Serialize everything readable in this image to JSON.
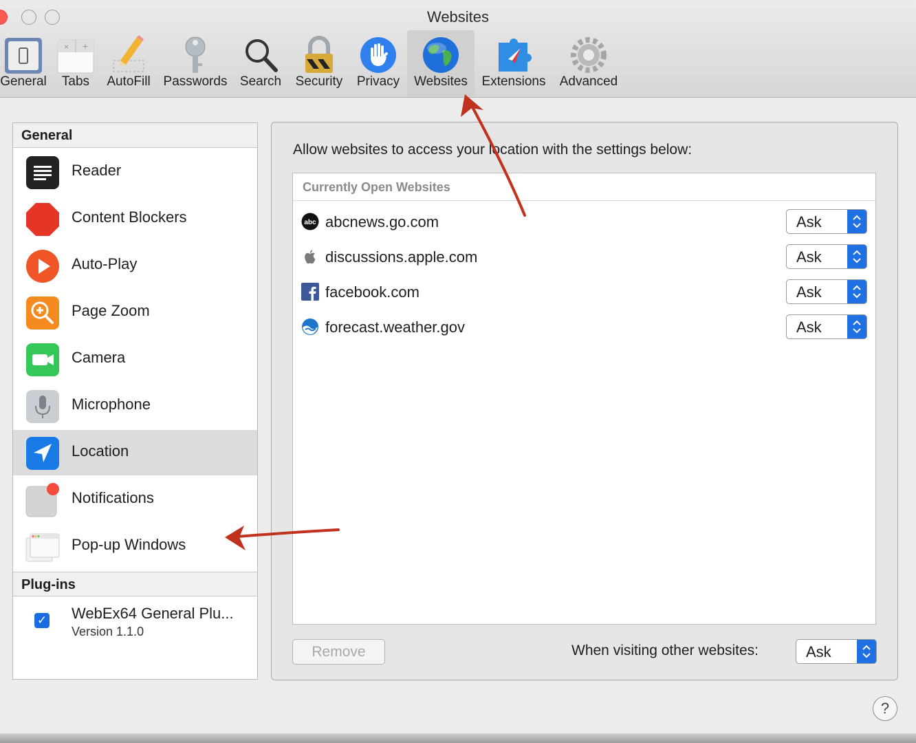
{
  "window": {
    "title": "Websites"
  },
  "toolbar": {
    "items": [
      {
        "label": "General",
        "icon": "general-switch-icon"
      },
      {
        "label": "Tabs",
        "icon": "tabs-icon"
      },
      {
        "label": "AutoFill",
        "icon": "pencil-icon"
      },
      {
        "label": "Passwords",
        "icon": "key-icon"
      },
      {
        "label": "Search",
        "icon": "magnifier-icon"
      },
      {
        "label": "Security",
        "icon": "padlock-icon"
      },
      {
        "label": "Privacy",
        "icon": "hand-icon"
      },
      {
        "label": "Websites",
        "icon": "globe-icon",
        "selected": true
      },
      {
        "label": "Extensions",
        "icon": "puzzle-piece-icon"
      },
      {
        "label": "Advanced",
        "icon": "gear-icon"
      }
    ]
  },
  "sidebar": {
    "general_header": "General",
    "items": [
      {
        "label": "Reader",
        "icon": "reader-icon"
      },
      {
        "label": "Content Blockers",
        "icon": "stop-sign-icon"
      },
      {
        "label": "Auto-Play",
        "icon": "play-icon"
      },
      {
        "label": "Page Zoom",
        "icon": "zoom-icon"
      },
      {
        "label": "Camera",
        "icon": "camera-icon"
      },
      {
        "label": "Microphone",
        "icon": "microphone-icon"
      },
      {
        "label": "Location",
        "icon": "location-arrow-icon",
        "selected": true
      },
      {
        "label": "Notifications",
        "icon": "notification-icon"
      },
      {
        "label": "Pop-up Windows",
        "icon": "popup-window-icon"
      }
    ],
    "plugins_header": "Plug-ins",
    "plugins": [
      {
        "name": "WebEx64 General Plu...",
        "version": "Version 1.1.0",
        "checked": true
      }
    ]
  },
  "panel": {
    "instruction": "Allow websites to access your location with the settings below:",
    "table_header": "Currently Open Websites",
    "sites": [
      {
        "name": "abcnews.go.com",
        "icon": "abc-logo-icon",
        "setting": "Ask"
      },
      {
        "name": "discussions.apple.com",
        "icon": "apple-logo-icon",
        "setting": "Ask"
      },
      {
        "name": "facebook.com",
        "icon": "facebook-logo-icon",
        "setting": "Ask"
      },
      {
        "name": "forecast.weather.gov",
        "icon": "noaa-logo-icon",
        "setting": "Ask"
      }
    ],
    "remove_label": "Remove",
    "other_label": "When visiting other websites:",
    "other_setting": "Ask"
  },
  "help_label": "?",
  "colors": {
    "accent": "#1a6de0",
    "annotation_arrow": "#c0321e",
    "selected_tab_bg": "#d0d0d0"
  }
}
